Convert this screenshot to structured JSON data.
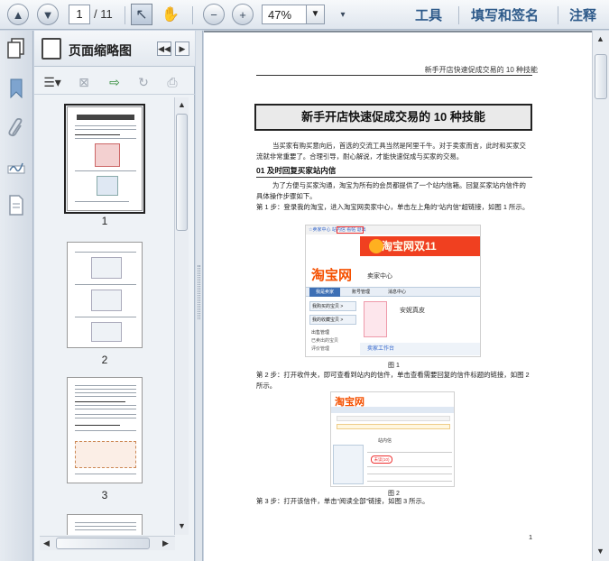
{
  "toolbar": {
    "current_page": "1",
    "total_pages": "/ 11",
    "zoom": "47%",
    "menu_tools": "工具",
    "menu_sign": "填写和签名",
    "menu_comment": "注释"
  },
  "panel": {
    "title": "页面缩略图",
    "thumbnails": [
      {
        "label": "1"
      },
      {
        "label": "2"
      },
      {
        "label": "3"
      }
    ]
  },
  "document": {
    "header": "新手开店快速促成交易的 10 种技能",
    "title": "新手开店快速促成交易的 10 种技能",
    "intro": "当买家有购买意向后，首选的交流工具当然是阿里千牛。对于卖家而言，此时和买家交流就非常重要了。合理引导，耐心解说，才能快速促成与买家的交易。",
    "section1": "01  及时回复买家站内信",
    "section1_body": "为了方便与买家沟通，淘宝为所有的会员都提供了一个站内信箱。回复买家站内信件的具体操作步骤如下。",
    "step1": "第 1 步：登录我的淘宝，进入淘宝网卖家中心，单击左上角的“站内信”超链接，如图 1 所示。",
    "fig1_caption": "图 1",
    "step2": "第 2 步：打开收件夹，即可查看到站内的信件，单击查看需要回复的信件标题的链接，如图 2 所示。",
    "fig2_caption": "图 2",
    "step3": "第 3 步：打开该信件，单击“阅读全部”链接，如图 3 所示。",
    "page_number": "1",
    "fig1": {
      "top_links": "☆卖家中心 站内信 看帖 退出",
      "banner": "淘宝网双11",
      "logo": "淘宝网",
      "logo_sub": "卖家中心",
      "tabs": [
        "我是卖家",
        "账号管理",
        "消息中心"
      ],
      "menu": [
        "我购买的宝贝 >",
        "我的收藏宝贝 >",
        "出售管理",
        "已卖出的宝贝",
        "评价管理"
      ],
      "shop_name": "安妮真皮",
      "workbench": "卖家工作台"
    },
    "fig2": {
      "logo": "淘宝网",
      "row_new": "未读(10)",
      "label": "站内信"
    }
  }
}
